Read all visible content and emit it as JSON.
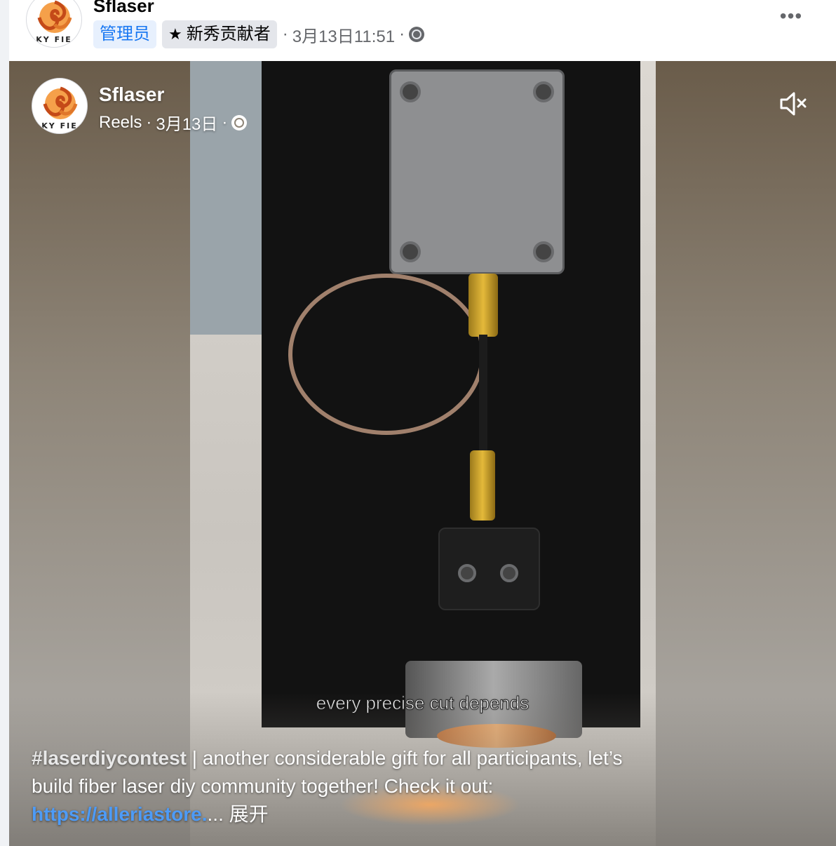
{
  "post": {
    "page_name": "Sflaser",
    "avatar_text": "KY FIE",
    "admin_badge": "管理员",
    "contributor_badge": "新秀贡献者",
    "separator": "·",
    "timestamp": "3月13日11:51",
    "more_label": "•••"
  },
  "video": {
    "page_name": "Sflaser",
    "avatar_text": "KY FIE",
    "meta_type": "Reels",
    "separator": "·",
    "date": "3月13日",
    "subtitle": "every precise cut depends",
    "caption": {
      "hashtag": "#laserdiycontest",
      "text_line1": " | another considerable gift for all participants, let’s",
      "text_line2": "build fiber laser diy community together! Check it out:",
      "link": "https://alleriastore.",
      "ellipsis": "... ",
      "expand": "展开"
    }
  },
  "colors": {
    "accent": "#1877f2",
    "link": "#4d9bf7",
    "meta_text": "#65676b"
  },
  "icons": [
    "star-icon",
    "globe-icon",
    "more-icon",
    "mute-icon"
  ]
}
